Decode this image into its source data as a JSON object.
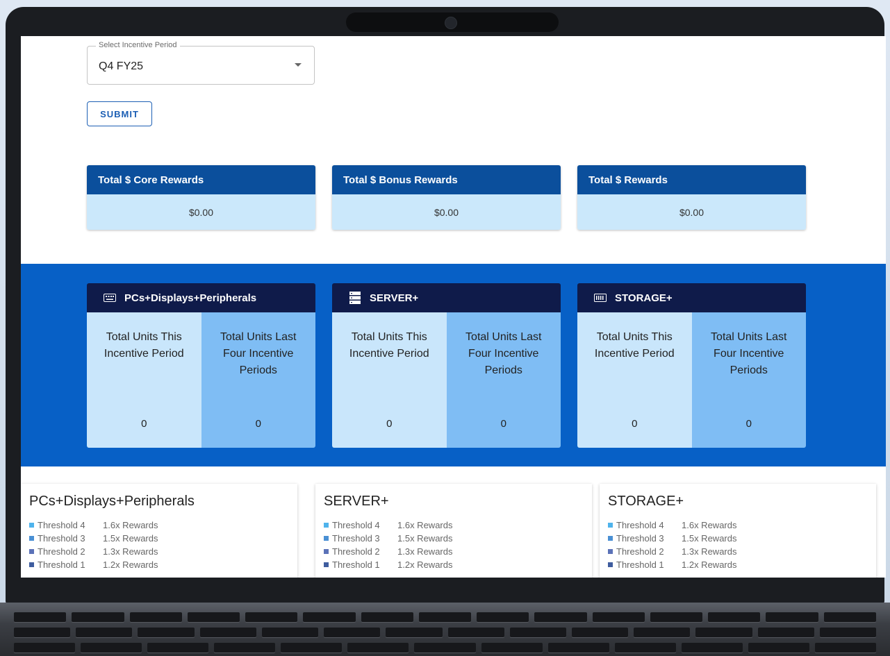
{
  "period_select": {
    "label": "Select Incentive Period",
    "value": "Q4 FY25"
  },
  "submit_label": "SUBMIT",
  "reward_cards": [
    {
      "title": "Total $ Core Rewards",
      "value": "$0.00"
    },
    {
      "title": "Total $ Bonus Rewards",
      "value": "$0.00"
    },
    {
      "title": "Total $ Rewards",
      "value": "$0.00"
    }
  ],
  "unit_cards": [
    {
      "title": "PCs+Displays+Peripherals",
      "icon": "keyboard-icon",
      "left_label": "Total Units This Incentive Period",
      "left_value": "0",
      "right_label": "Total Units Last Four Incentive Periods",
      "right_value": "0"
    },
    {
      "title": "SERVER+",
      "icon": "server-icon",
      "left_label": "Total Units This Incentive Period",
      "left_value": "0",
      "right_label": "Total Units Last Four Incentive Periods",
      "right_value": "0"
    },
    {
      "title": "STORAGE+",
      "icon": "storage-icon",
      "left_label": "Total Units This Incentive Period",
      "left_value": "0",
      "right_label": "Total Units Last Four Incentive Periods",
      "right_value": "0"
    }
  ],
  "threshold_cards": [
    {
      "title": "PCs+Displays+Peripherals",
      "items": [
        {
          "name": "Threshold 4",
          "reward": "1.6x Rewards"
        },
        {
          "name": "Threshold 3",
          "reward": "1.5x Rewards"
        },
        {
          "name": "Threshold 2",
          "reward": "1.3x Rewards"
        },
        {
          "name": "Threshold 1",
          "reward": "1.2x Rewards"
        }
      ]
    },
    {
      "title": "SERVER+",
      "items": [
        {
          "name": "Threshold 4",
          "reward": "1.6x Rewards"
        },
        {
          "name": "Threshold 3",
          "reward": "1.5x Rewards"
        },
        {
          "name": "Threshold 2",
          "reward": "1.3x Rewards"
        },
        {
          "name": "Threshold 1",
          "reward": "1.2x Rewards"
        }
      ]
    },
    {
      "title": "STORAGE+",
      "items": [
        {
          "name": "Threshold 4",
          "reward": "1.6x Rewards"
        },
        {
          "name": "Threshold 3",
          "reward": "1.5x Rewards"
        },
        {
          "name": "Threshold 2",
          "reward": "1.3x Rewards"
        },
        {
          "name": "Threshold 1",
          "reward": "1.2x Rewards"
        }
      ]
    }
  ],
  "colors": {
    "reward_header": "#0b4f9c",
    "reward_body": "#cbe8fb",
    "band": "#0760c6",
    "unit_header": "#0f1b4a",
    "unit_left": "#c9e6fb",
    "unit_right": "#7fbdf4",
    "threshold_dots": [
      "#4fb3ec",
      "#4a90d4",
      "#5b72b8",
      "#3f5d9f"
    ]
  }
}
